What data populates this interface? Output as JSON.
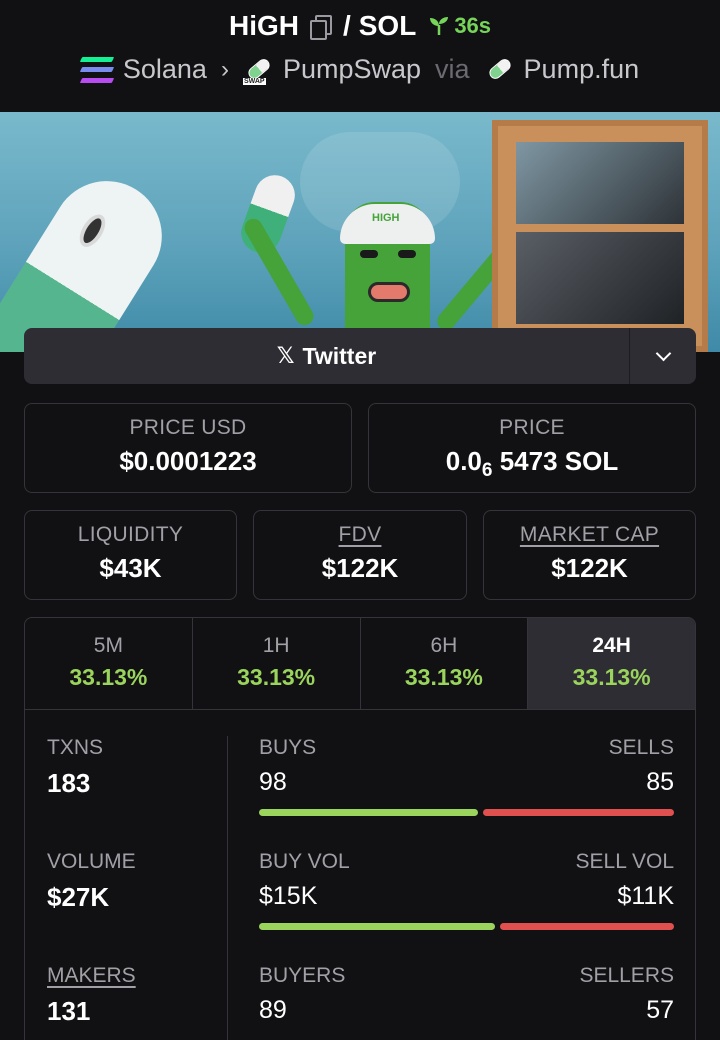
{
  "header": {
    "token": "HiGH",
    "separator": "/",
    "quote": "SOL",
    "age": "36s",
    "chain": "Solana",
    "dex": "PumpSwap",
    "via": "via",
    "launchpad": "Pump.fun",
    "swap_tag": "SWAP"
  },
  "banner": {
    "hat_text": "HIGH"
  },
  "social": {
    "twitter_label": "Twitter"
  },
  "prices": {
    "usd_label": "PRICE USD",
    "usd_value": "$0.0001223",
    "native_label": "PRICE",
    "native_prefix": "0.0",
    "native_zeros": "6",
    "native_rest": "5473 SOL"
  },
  "metrics": {
    "liquidity_label": "LIQUIDITY",
    "liquidity_value": "$43K",
    "fdv_label": "FDV",
    "fdv_value": "$122K",
    "mcap_label": "MARKET CAP",
    "mcap_value": "$122K"
  },
  "tabs": [
    {
      "label": "5M",
      "change": "33.13%"
    },
    {
      "label": "1H",
      "change": "33.13%"
    },
    {
      "label": "6H",
      "change": "33.13%"
    },
    {
      "label": "24H",
      "change": "33.13%"
    }
  ],
  "stats": {
    "txns_label": "TXNS",
    "txns_value": "183",
    "volume_label": "VOLUME",
    "volume_value": "$27K",
    "makers_label": "MAKERS",
    "makers_value": "131",
    "buys_label": "BUYS",
    "buys_value": "98",
    "sells_label": "SELLS",
    "sells_value": "85",
    "buyvol_label": "BUY VOL",
    "buyvol_value": "$15K",
    "sellvol_label": "SELL VOL",
    "sellvol_value": "$11K",
    "buyers_label": "BUYERS",
    "buyers_value": "89",
    "sellers_label": "SELLERS",
    "sellers_value": "57",
    "buy_ratio_txns": 0.535,
    "buy_ratio_vol": 0.575
  },
  "colors": {
    "positive": "#9ad45c",
    "negative": "#e0504e",
    "age": "#76d45a"
  }
}
